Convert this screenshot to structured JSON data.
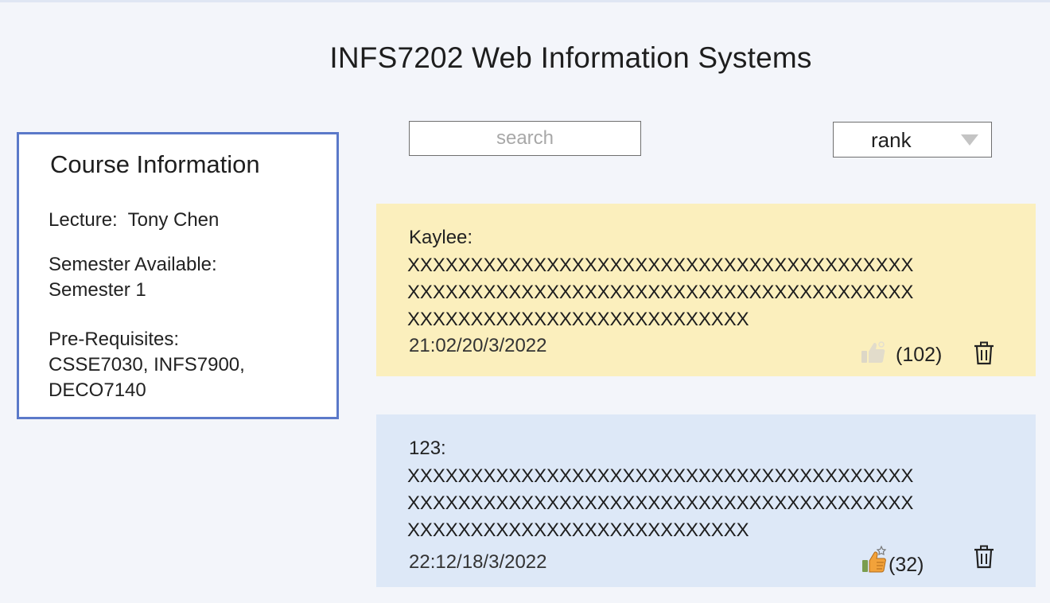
{
  "page": {
    "title": "INFS7202 Web Information Systems"
  },
  "course_info": {
    "heading": "Course Information",
    "lecture_label": "Lecture:",
    "lecture_value": "Tony Chen",
    "semester_label": "Semester Available:",
    "semester_value": "Semester 1",
    "prereq_label": "Pre-Requisites:",
    "prereq_line1": "CSSE7030, INFS7900,",
    "prereq_line2": "DECO7140"
  },
  "search": {
    "placeholder": "search",
    "value": ""
  },
  "sort": {
    "selected": "rank"
  },
  "comments": [
    {
      "author": "Kaylee:",
      "text_lines": [
        "XXXXXXXXXXXXXXXXXXXXXXXXXXXXXXXXXXXXXXXX",
        "XXXXXXXXXXXXXXXXXXXXXXXXXXXXXXXXXXXXXXXX",
        "XXXXXXXXXXXXXXXXXXXXXXXXXXX"
      ],
      "timestamp": "21:02/20/3/2022",
      "likes": "(102)",
      "liked": false,
      "background": "#fbefbd"
    },
    {
      "author": "123:",
      "text_lines": [
        "XXXXXXXXXXXXXXXXXXXXXXXXXXXXXXXXXXXXXXXX",
        "XXXXXXXXXXXXXXXXXXXXXXXXXXXXXXXXXXXXXXXX",
        "XXXXXXXXXXXXXXXXXXXXXXXXXXX"
      ],
      "timestamp": "22:12/18/3/2022",
      "likes": "(32)",
      "liked": true,
      "background": "#dde8f7"
    }
  ],
  "icons": {
    "like": "thumbs-up-icon",
    "delete": "trash-icon",
    "dropdown": "triangle-down-icon"
  },
  "colors": {
    "panel_border": "#5b79c9",
    "liked_thumb": "#f2a23a",
    "unliked_thumb": "#d9d4c4"
  }
}
